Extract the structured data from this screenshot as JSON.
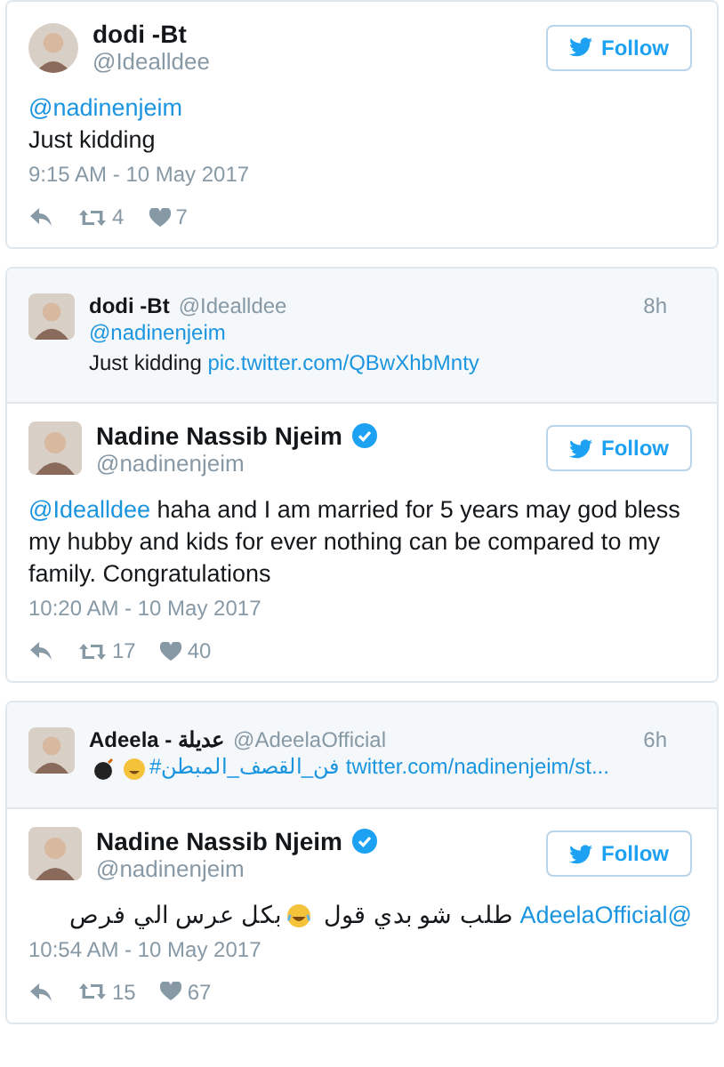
{
  "cards": [
    {
      "tweet": {
        "name": "dodi -Bt",
        "handle": "@Idealldee",
        "verified": false,
        "follow": "Follow",
        "lines": [
          [
            {
              "kind": "mention",
              "text": "@nadinenjeim"
            }
          ],
          [
            {
              "kind": "text",
              "text": "Just kidding"
            }
          ]
        ],
        "rtl": false,
        "time": "9:15 AM - 10 May 2017",
        "retweets": "4",
        "likes": "7"
      }
    },
    {
      "quote": {
        "name": "dodi -Bt",
        "handle": "@Idealldee",
        "age": "8h",
        "lines": [
          [
            {
              "kind": "mention",
              "text": "@nadinenjeim"
            }
          ],
          [
            {
              "kind": "text",
              "text": "Just kidding"
            },
            {
              "kind": "link",
              "text": "pic.twitter.com/QBwXhbMnty"
            }
          ]
        ]
      },
      "tweet": {
        "name": "Nadine Nassib Njeim",
        "handle": "@nadinenjeim",
        "verified": true,
        "follow": "Follow",
        "lines": [
          [
            {
              "kind": "mention",
              "text": "@Idealldee"
            },
            {
              "kind": "text",
              "text": "haha and I am married for 5 years may god bless my hubby and kids for ever nothing can be compared to my family. Congratulations"
            }
          ]
        ],
        "rtl": false,
        "time": "10:20 AM - 10 May 2017",
        "retweets": "17",
        "likes": "40"
      }
    },
    {
      "quote": {
        "name": "Adeela - عديلة",
        "handle": "@AdeelaOfficial",
        "age": "6h",
        "lines": [
          [
            {
              "kind": "bomb"
            },
            {
              "kind": "grin"
            },
            {
              "kind": "hashtag",
              "text": "#فن_القصف_المبطن"
            },
            {
              "kind": "link",
              "text": "twitter.com/nadinenjeim/st..."
            }
          ]
        ]
      },
      "tweet": {
        "name": "Nadine Nassib Njeim",
        "handle": "@nadinenjeim",
        "verified": true,
        "follow": "Follow",
        "lines": [
          [
            {
              "kind": "mention",
              "text": "@AdeelaOfficial"
            },
            {
              "kind": "text",
              "text": "طلب شو بدي قول"
            },
            {
              "kind": "laugh"
            },
            {
              "kind": "text",
              "text": "بكل عرس الي فرص"
            }
          ]
        ],
        "rtl": true,
        "time": "10:54 AM - 10 May 2017",
        "retweets": "15",
        "likes": "67"
      }
    }
  ]
}
